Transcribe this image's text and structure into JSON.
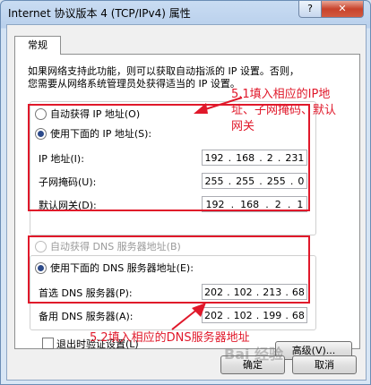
{
  "window": {
    "title": "Internet 协议版本 4 (TCP/IPv4) 属性",
    "help_label": "?",
    "close_label": "✕"
  },
  "tab": {
    "label": "常规"
  },
  "description": {
    "line1": "如果网络支持此功能，则可以获取自动指派的 IP 设置。否则，",
    "line2": "您需要从网络系统管理员处获得适当的 IP 设置。"
  },
  "ip": {
    "auto_label": "自动获得 IP 地址(O)",
    "manual_label": "使用下面的 IP 地址(S):",
    "address_label": "IP 地址(I):",
    "address": [
      "192",
      "168",
      "2",
      "231"
    ],
    "mask_label": "子网掩码(U):",
    "mask": [
      "255",
      "255",
      "255",
      "0"
    ],
    "gateway_label": "默认网关(D):",
    "gateway": [
      "192",
      "168",
      "2",
      "1"
    ]
  },
  "dns": {
    "auto_label": "自动获得 DNS 服务器地址(B)",
    "manual_label": "使用下面的 DNS 服务器地址(E):",
    "preferred_label": "首选 DNS 服务器(P):",
    "preferred": [
      "202",
      "102",
      "213",
      "68"
    ],
    "alternate_label": "备用 DNS 服务器(A):",
    "alternate": [
      "202",
      "102",
      "199",
      "68"
    ]
  },
  "validate_label": "退出时验证设置(L)",
  "advanced_label": "高级(V)...",
  "ok_label": "确定",
  "cancel_label": "取消",
  "annotations": {
    "ip_note": [
      "5.1填入相应的IP地",
      "址、子网掩码、默认",
      "网关"
    ],
    "dns_note": "5.2填入相应的DNS服务器地址"
  },
  "watermark": "Bai 经验",
  "colors": {
    "annotation": "#e0182a",
    "selected_radio": "#2c4a8a"
  }
}
